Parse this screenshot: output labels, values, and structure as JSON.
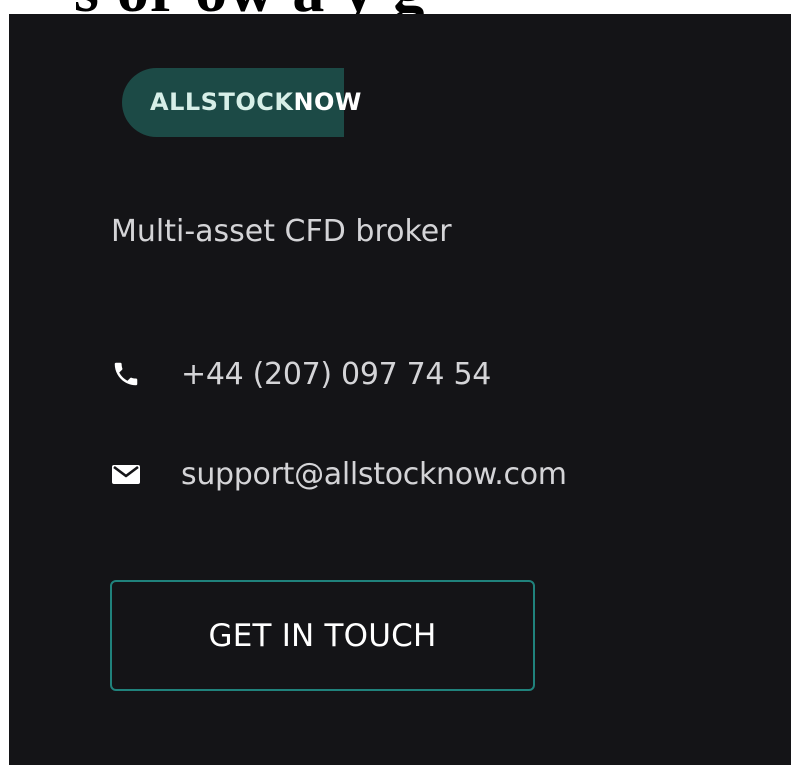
{
  "colors": {
    "panel_bg": "#141417",
    "logo_pill": "#1c4a46",
    "accent_border": "#20827c",
    "text": "#d4d4d7"
  },
  "top_strip": {
    "text": "s or  ow    a y   g"
  },
  "logo": {
    "part1": "ALLSTOCK",
    "part2": "NOW"
  },
  "tagline": "Multi-asset CFD broker",
  "contact": {
    "phone": {
      "icon": "phone-icon",
      "text": "+44 (207) 097 74 54"
    },
    "email": {
      "icon": "envelope-icon",
      "text": "support@allstocknow.com"
    }
  },
  "cta": {
    "label": "GET IN TOUCH"
  }
}
